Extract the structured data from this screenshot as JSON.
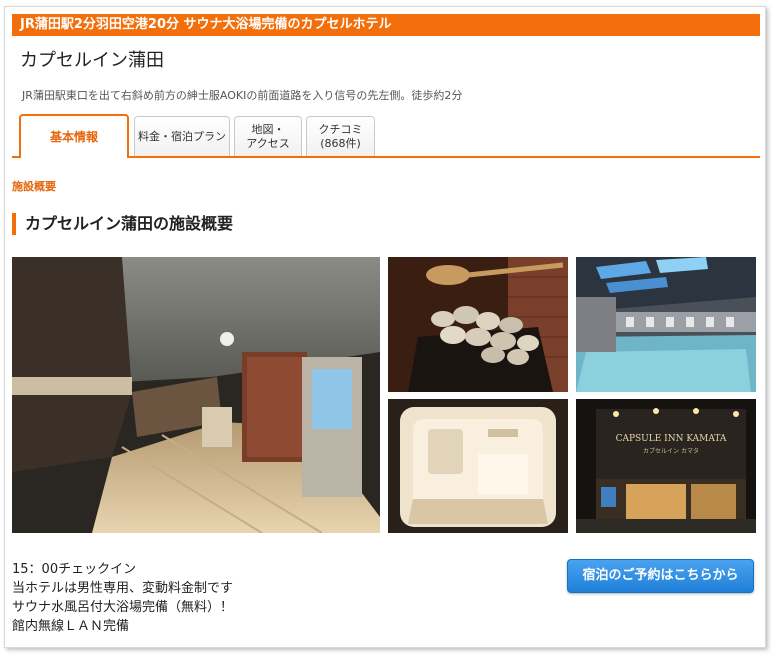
{
  "catch_copy": "JR蒲田駅2分羽田空港20分 サウナ大浴場完備のカプセルホテル",
  "hotel": {
    "name": "カプセルイン蒲田",
    "access": "JR蒲田駅東口を出て右斜め前方の紳士服AOKIの前面道路を入り信号の先左側。徒歩約2分"
  },
  "tabs": [
    {
      "label": "基本情報",
      "active": true
    },
    {
      "label": "料金・宿泊プラン",
      "active": false
    },
    {
      "label": "地図・\nアクセス",
      "active": false
    },
    {
      "label": "クチコミ\n(868件)",
      "active": false
    }
  ],
  "breadcrumb": "施設概要",
  "section_title": "カプセルイン蒲田の施設概要",
  "photos": {
    "signage_text": "CAPSULE INN KAMATA",
    "signage_sub": "カプセルイン カマタ"
  },
  "description": [
    "15：00チェックイン",
    "当ホテルは男性専用、変動料金制です",
    "サウナ水風呂付大浴場完備（無料）！",
    "館内無線ＬＡＮ完備"
  ],
  "reserve_button": "宿泊のご予約はこちらから",
  "colors": {
    "accent": "#f26f0c",
    "button": "#1f7fd8"
  }
}
